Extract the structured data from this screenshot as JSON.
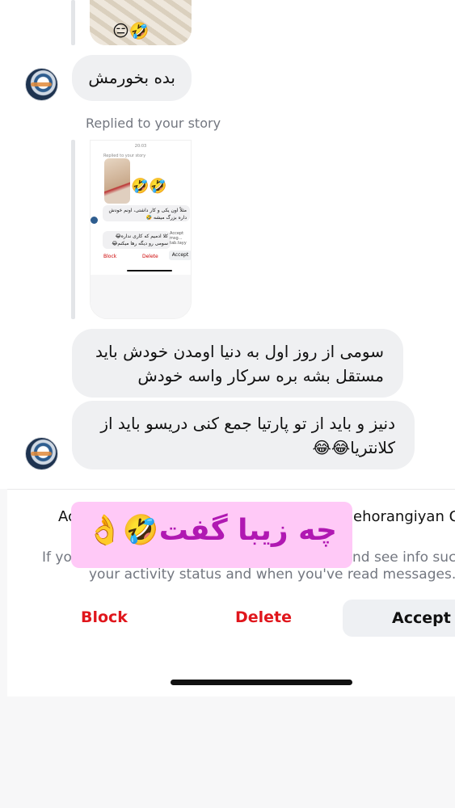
{
  "chat": {
    "story_thumb_emoji": "😑🤣",
    "msg_1": "بده بخورمش",
    "replied_label": "Replied to your story",
    "story_preview": {
      "time": "20:03",
      "label": "Replied to your story",
      "emoji": "🤣🤣",
      "bubble_1": "مثلاً اون یکی و کار داشتی، اونم خودش داره بزرگ میشه 🤣",
      "bubble_2": "کلا ادمیم که کاری نداره😂 سومی رو دیگه رها میکنم😂",
      "side_text": "Accept msg… tab.tayy",
      "block": "Block",
      "delete": "Delete",
      "accept": "Accept"
    },
    "msg_2_line1": "سومی از روز اول به دنیا اومدن خودش باید",
    "msg_2_line2": "مستقل بشه بره سرکار واسه خودش",
    "msg_3_line1": "دنیز و باید از تو پارتیا جمع کنی دریسو باید از",
    "msg_3_line2": "کلانتریا😂😂"
  },
  "request_panel": {
    "line1_start": "Ac",
    "line1_end": "ehorangiyan O",
    "line2_start": "If yo",
    "line2_end": "nd see info such",
    "line3": "your activity status and when you've read messages.",
    "block_label": "Block",
    "delete_label": "Delete",
    "accept_label": "Accept"
  },
  "sticker": {
    "text": "چه زیبا گفت🤣👌"
  },
  "colors": {
    "danger": "#e0161c",
    "bubble": "#eff0f2",
    "sticker_bg": "#ffc9f7",
    "sticker_text": "#b018b2",
    "muted": "#737780"
  }
}
